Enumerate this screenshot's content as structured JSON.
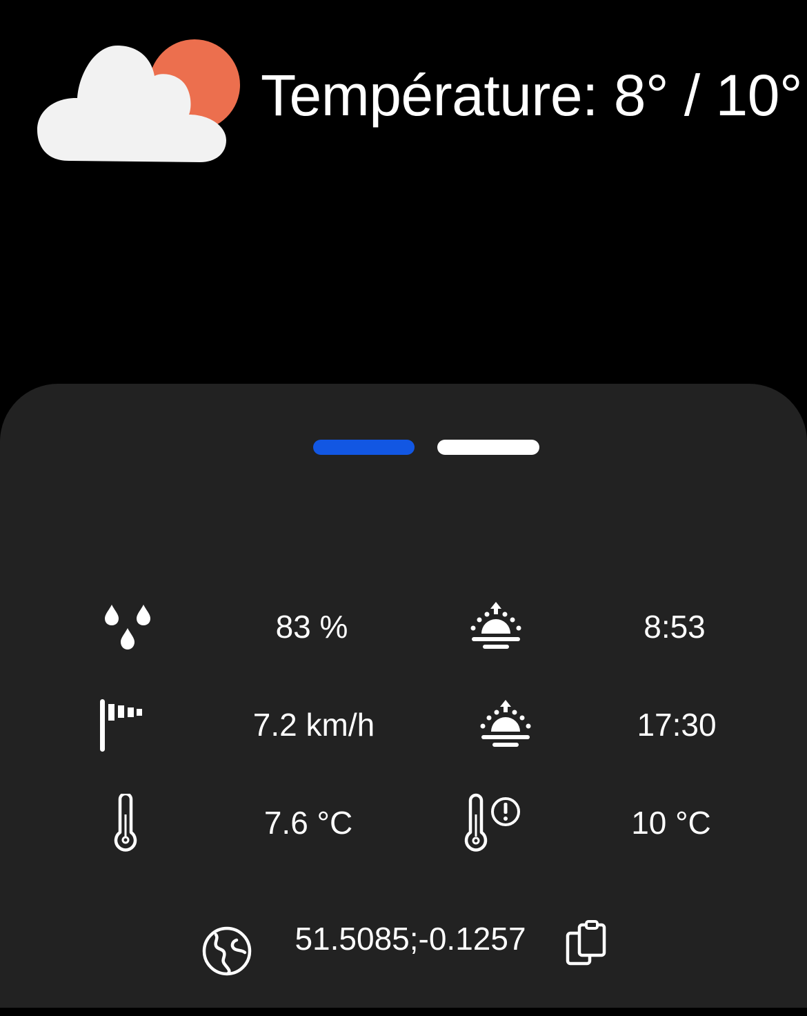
{
  "header": {
    "weather_icon": "partly-cloudy-icon",
    "temperature_text": "Température: 8° / 10°"
  },
  "pager": {
    "pages": 2,
    "active_page": 1,
    "active_color": "#1257e3",
    "inactive_color": "#ffffff"
  },
  "stats": {
    "humidity": {
      "icon": "humidity-drops-icon",
      "value": "83 %"
    },
    "sunrise": {
      "icon": "sunrise-icon",
      "value": "8:53"
    },
    "wind": {
      "icon": "windsock-icon",
      "value": "7.2 km/h"
    },
    "sunset": {
      "icon": "sunset-icon",
      "value": "17:30"
    },
    "current_temp": {
      "icon": "thermometer-icon",
      "value": "7.6 °C"
    },
    "feels_like": {
      "icon": "thermometer-alert-icon",
      "value": "10 °C"
    }
  },
  "location": {
    "icon": "globe-icon",
    "coordinates": "51.5085;-0.1257",
    "copy_icon": "clipboard-copy-icon"
  },
  "colors": {
    "background": "#000000",
    "panel": "#222222",
    "sun": "#ec6f4e",
    "cloud": "#f2f2f2"
  }
}
